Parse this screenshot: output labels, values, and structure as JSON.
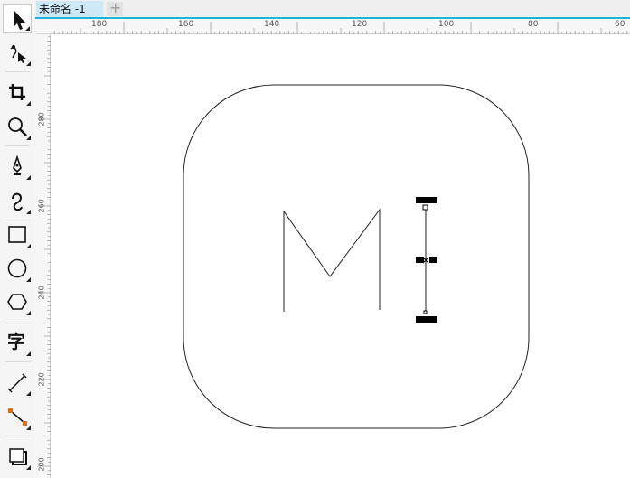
{
  "document": {
    "tab_title": "未命名 -1",
    "add_tab_symbol": "+"
  },
  "rulers": {
    "horizontal": [
      "180",
      "160",
      "140",
      "120",
      "100",
      "80",
      "60"
    ],
    "vertical": [
      "280",
      "260",
      "240",
      "220",
      "200"
    ]
  },
  "toolbox": [
    {
      "icon": "pointer-icon"
    },
    {
      "icon": "shape-edit-icon"
    },
    {
      "icon": "crop-icon"
    },
    {
      "icon": "zoom-icon"
    },
    {
      "icon": "freehand-pen-icon"
    },
    {
      "icon": "artistic-media-icon"
    },
    {
      "icon": "rectangle-icon"
    },
    {
      "icon": "ellipse-icon"
    },
    {
      "icon": "polygon-icon"
    },
    {
      "icon": "text-icon",
      "glyph": "字"
    },
    {
      "icon": "parallel-dimension-icon"
    },
    {
      "icon": "connector-icon"
    },
    {
      "icon": "drop-shadow-icon"
    }
  ],
  "colors": {
    "tab_accent": "#1bb5d8",
    "connector_accent": "#e06a1e"
  }
}
